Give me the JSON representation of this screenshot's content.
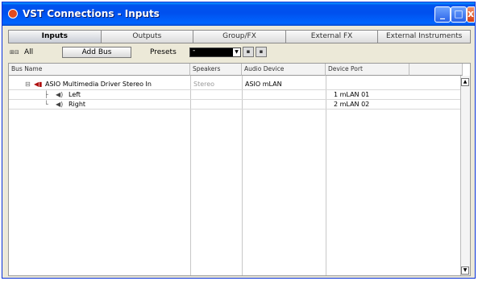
{
  "window": {
    "title": "VST Connections - Inputs"
  },
  "window_buttons": {
    "minimize": "_",
    "maximize": "□",
    "close": "x"
  },
  "tabs": [
    {
      "label": "Inputs",
      "active": true
    },
    {
      "label": "Outputs",
      "active": false
    },
    {
      "label": "Group/FX",
      "active": false
    },
    {
      "label": "External FX",
      "active": false
    },
    {
      "label": "External Instruments",
      "active": false
    }
  ],
  "toolbar": {
    "expand_all_icon": "⊞⊟",
    "all_label": "All",
    "add_bus_label": "Add Bus",
    "presets_label": "Presets",
    "presets_value": "-",
    "presets_arrow": "▼"
  },
  "columns": {
    "bus_name": "Bus Name",
    "speakers": "Speakers",
    "audio_device": "Audio Device",
    "device_port": "Device Port"
  },
  "rows": [
    {
      "tree": "⊟",
      "name": "ASIO Multimedia Driver Stereo In",
      "speakers": "Stereo",
      "audio_device": "ASIO mLAN",
      "device_port": ""
    },
    {
      "tree": "├",
      "name": "Left",
      "speakers": "",
      "audio_device": "",
      "device_port": "1 mLAN 01"
    },
    {
      "tree": "└",
      "name": "Right",
      "speakers": "",
      "audio_device": "",
      "device_port": "2 mLAN 02"
    }
  ],
  "scroll": {
    "up": "▲",
    "down": "▼"
  }
}
